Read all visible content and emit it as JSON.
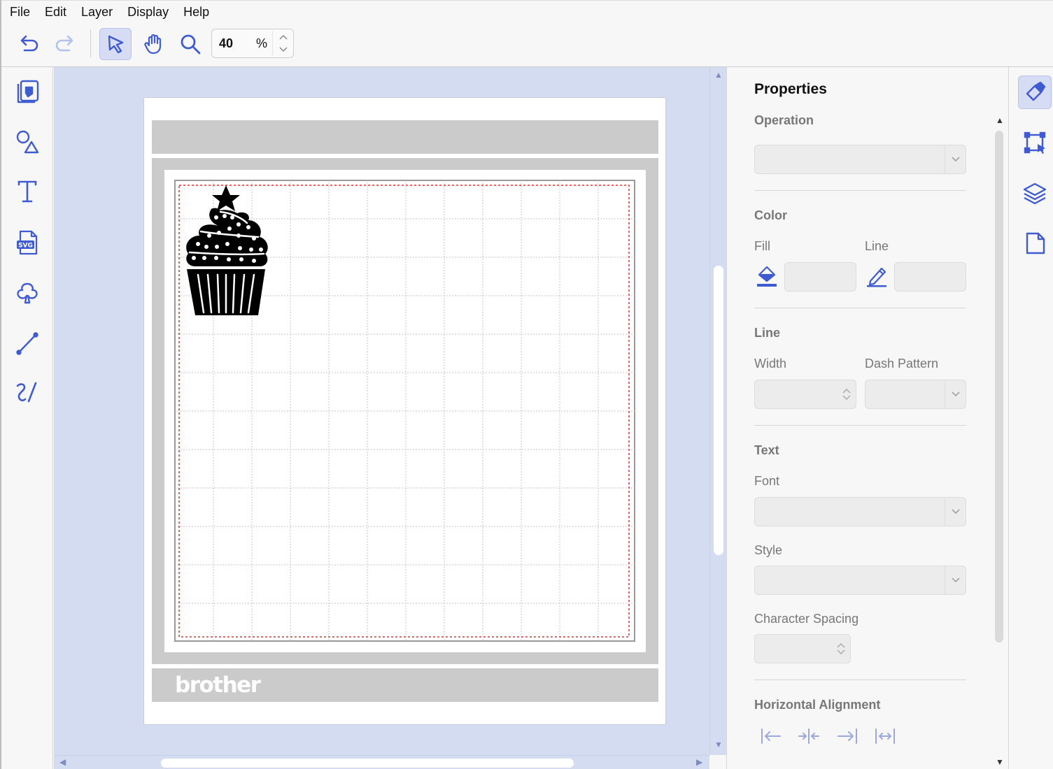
{
  "menu": {
    "file": "File",
    "edit": "Edit",
    "layer": "Layer",
    "display": "Display",
    "help": "Help"
  },
  "toolbar": {
    "zoom_value": "40",
    "zoom_unit": "%"
  },
  "canvas": {
    "brand_text": "brother",
    "object": "cupcake-image"
  },
  "properties": {
    "title": "Properties",
    "operation": {
      "heading": "Operation"
    },
    "color": {
      "heading": "Color",
      "fill_label": "Fill",
      "line_label": "Line"
    },
    "line": {
      "heading": "Line",
      "width_label": "Width",
      "dash_label": "Dash Pattern"
    },
    "text": {
      "heading": "Text",
      "font_label": "Font",
      "style_label": "Style",
      "spacing_label": "Character Spacing"
    },
    "halign": {
      "heading": "Horizontal Alignment"
    }
  },
  "colors": {
    "accent": "#3f5bd1",
    "canvas_bg": "#d3dcf1",
    "mat": "#cbcbcb",
    "cut_line": "#e0302c",
    "disabled": "#9aa8df"
  },
  "icons": {
    "left_rail": [
      "pattern-icon",
      "shapes-icon",
      "text-icon",
      "svg-icon",
      "outline-icon",
      "line-icon",
      "freehand-icon"
    ],
    "right_rail": [
      "paint-brush-icon",
      "transform-icon",
      "layers-icon",
      "page-icon"
    ]
  }
}
